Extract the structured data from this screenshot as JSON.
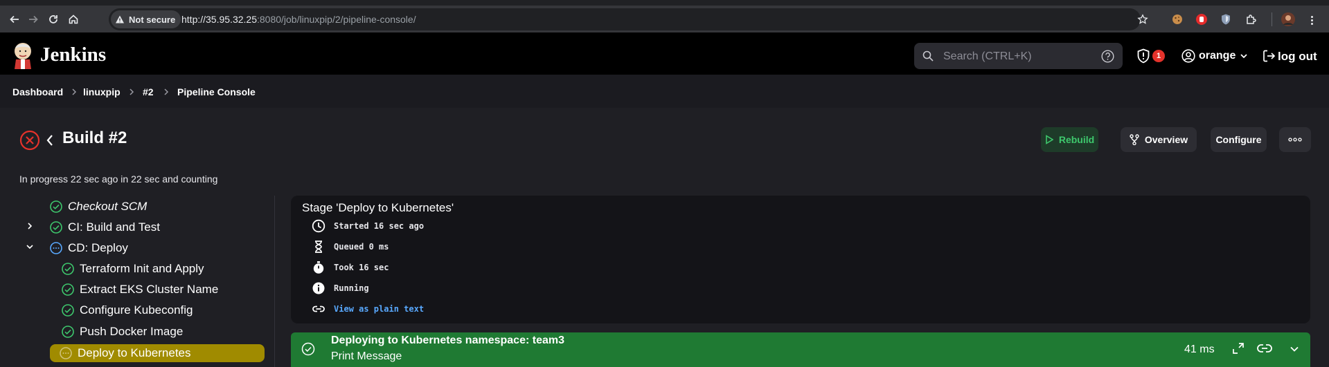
{
  "browser": {
    "security_label": "Not secure",
    "url_host": "http://35.95.32.25",
    "url_rest": ":8080/job/linuxpip/2/pipeline-console/"
  },
  "header": {
    "app_name": "Jenkins",
    "search_placeholder": "Search (CTRL+K)",
    "security_count": "1",
    "username": "orange",
    "logout_label": "log out"
  },
  "breadcrumb": [
    "Dashboard",
    "linuxpip",
    "#2",
    "Pipeline Console"
  ],
  "build": {
    "title": "Build #2",
    "status": "In progress 22 sec ago in 22 sec and counting",
    "actions": {
      "rebuild": "Rebuild",
      "overview": "Overview",
      "configure": "Configure"
    }
  },
  "tree": [
    {
      "label": "Checkout SCM",
      "state": "success"
    },
    {
      "label": "CI: Build and Test",
      "state": "success"
    },
    {
      "label": "CD: Deploy",
      "state": "running"
    },
    {
      "label": "Terraform Init and Apply",
      "state": "success"
    },
    {
      "label": "Extract EKS Cluster Name",
      "state": "success"
    },
    {
      "label": "Configure Kubeconfig",
      "state": "success"
    },
    {
      "label": "Push Docker Image",
      "state": "success"
    },
    {
      "label": "Deploy to Kubernetes",
      "state": "running"
    }
  ],
  "stage": {
    "title": "Stage 'Deploy to Kubernetes'",
    "started": "Started 16 sec ago",
    "queued": "Queued 0 ms",
    "took": "Took 16 sec",
    "state": "Running",
    "plain_text_link": "View as plain text"
  },
  "step": {
    "title": "Deploying to Kubernetes namespace: team3",
    "subtitle": "Print Message",
    "duration": "41 ms"
  },
  "colors": {
    "success": "#3ec86d",
    "failure": "#e4322b",
    "running": "#59a9ff",
    "selected": "#a08b00",
    "step_bar": "#1f7a33"
  }
}
